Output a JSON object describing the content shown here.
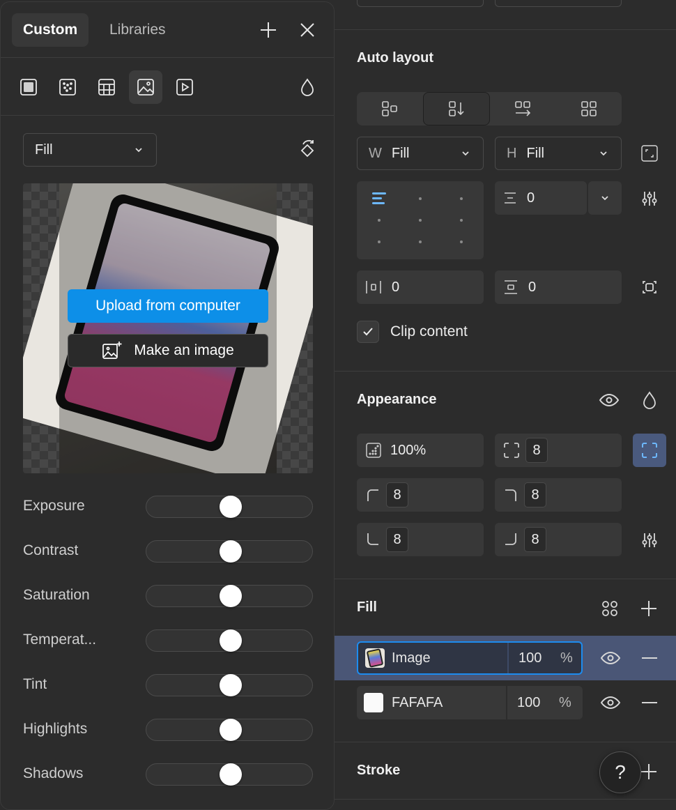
{
  "auto_layout": {
    "title": "Auto layout",
    "width": {
      "label": "W",
      "value": "Fill"
    },
    "height": {
      "label": "H",
      "value": "Fill"
    },
    "gap_value": "0",
    "padding_h": "0",
    "padding_v": "0",
    "clip_content_label": "Clip content",
    "clip_checked": true
  },
  "appearance": {
    "title": "Appearance",
    "opacity": "100%",
    "radius_all": "8",
    "radius_tl": "8",
    "radius_tr": "8",
    "radius_bl": "8",
    "radius_br": "8"
  },
  "fill": {
    "title": "Fill",
    "items": [
      {
        "name": "Image",
        "opacity": "100",
        "unit": "%",
        "selected": true
      },
      {
        "name": "FAFAFA",
        "opacity": "100",
        "unit": "%",
        "selected": false,
        "swatch": "#FAFAFA"
      }
    ]
  },
  "stroke": {
    "title": "Stroke"
  },
  "help_label": "?",
  "popover": {
    "tabs": [
      {
        "label": "Custom",
        "active": true
      },
      {
        "label": "Libraries",
        "active": false
      }
    ],
    "fill_type_icons": [
      "solid-fill-icon",
      "noise-fill-icon",
      "pattern-fill-icon",
      "image-fill-icon",
      "video-fill-icon"
    ],
    "active_fill_type": "image-fill-icon",
    "mode_select": "Fill",
    "upload_button": "Upload from computer",
    "make_image_button": "Make an image",
    "adjustments": [
      {
        "label": "Exposure",
        "value": 0.5
      },
      {
        "label": "Contrast",
        "value": 0.5
      },
      {
        "label": "Saturation",
        "value": 0.5
      },
      {
        "label": "Temperat...",
        "value": 0.5
      },
      {
        "label": "Tint",
        "value": 0.5
      },
      {
        "label": "Highlights",
        "value": 0.5
      },
      {
        "label": "Shadows",
        "value": 0.5
      }
    ]
  },
  "colors": {
    "accent": "#0D8FE8",
    "selection": "#4A5676",
    "panel": "#2C2C2C"
  }
}
